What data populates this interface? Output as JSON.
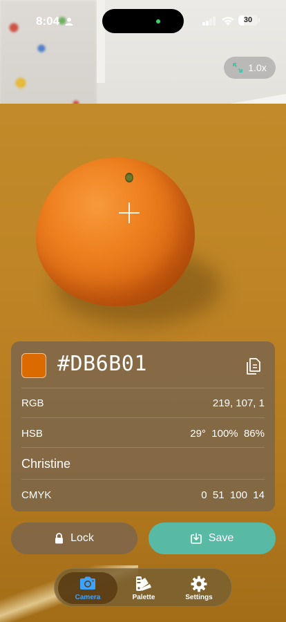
{
  "status_bar": {
    "time": "8:04",
    "battery_level": "30",
    "battery_fraction": 0.3
  },
  "zoom": {
    "label": "1.0x"
  },
  "color": {
    "hex": "#DB6B01",
    "swatch": "#DB6B01",
    "name": "Christine",
    "rows": {
      "rgb": {
        "label": "RGB",
        "value": "219, 107, 1"
      },
      "hsb": {
        "label": "HSB",
        "value": "29°  100%  86%"
      },
      "cmyk": {
        "label": "CMYK",
        "value": "0  51  100  14"
      }
    }
  },
  "actions": {
    "lock_label": "Lock",
    "save_label": "Save"
  },
  "tabs": [
    {
      "label": "Camera",
      "icon": "camera-icon",
      "active": true
    },
    {
      "label": "Palette",
      "icon": "palette-icon",
      "active": false
    },
    {
      "label": "Settings",
      "icon": "gear-icon",
      "active": false
    }
  ],
  "colors": {
    "accent": "#58B9A4",
    "active_tab": "#3EA3FF"
  }
}
